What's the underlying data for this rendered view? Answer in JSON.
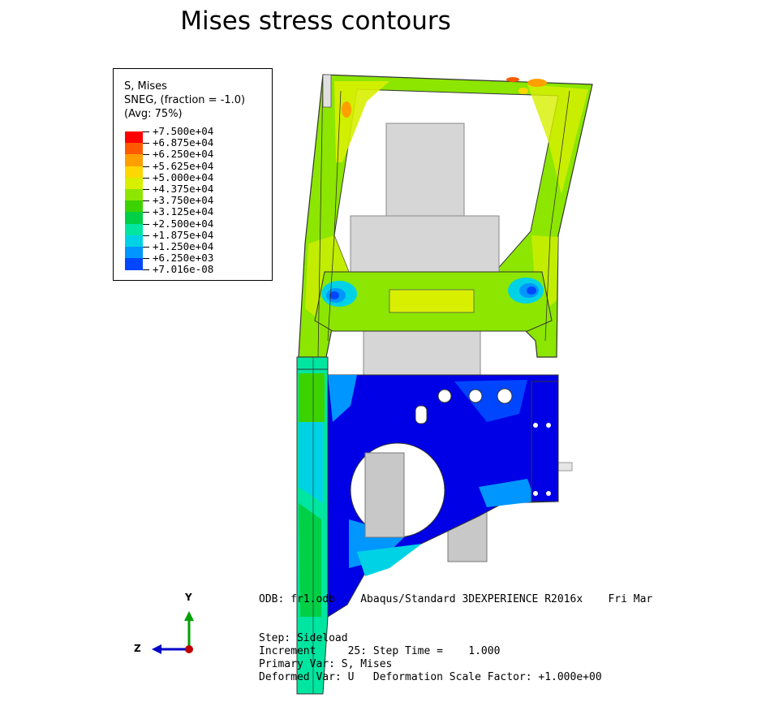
{
  "title": "Mises stress contours",
  "legend": {
    "header_lines": [
      "S, Mises",
      "SNEG, (fraction = -1.0)",
      "(Avg: 75%)"
    ],
    "levels": [
      "+7.500e+04",
      "+6.875e+04",
      "+6.250e+04",
      "+5.625e+04",
      "+5.000e+04",
      "+4.375e+04",
      "+3.750e+04",
      "+3.125e+04",
      "+2.500e+04",
      "+1.875e+04",
      "+1.250e+04",
      "+6.250e+03",
      "+7.016e-08"
    ],
    "colors": [
      "#ff0000",
      "#ff5a00",
      "#ffa000",
      "#ffd700",
      "#d8f000",
      "#8ce600",
      "#3cd200",
      "#00d046",
      "#00e6a0",
      "#00d2e6",
      "#0096ff",
      "#0046ff",
      "#0000e6"
    ]
  },
  "info": {
    "odb_line": "ODB: fr1.odb    Abaqus/Standard 3DEXPERIENCE R2016x    Fri Mar",
    "step_line": "Step: Sideload",
    "increment_line": "Increment     25: Step Time =    1.000",
    "primary_var_line": "Primary Var: S, Mises",
    "deformed_var_line": "Deformed Var: U   Deformation Scale Factor: +1.000e+00"
  },
  "triad": {
    "y_label": "Y",
    "z_label": "Z",
    "y_color": "#00a000",
    "z_color": "#0000c8",
    "x_color": "#c00000"
  }
}
